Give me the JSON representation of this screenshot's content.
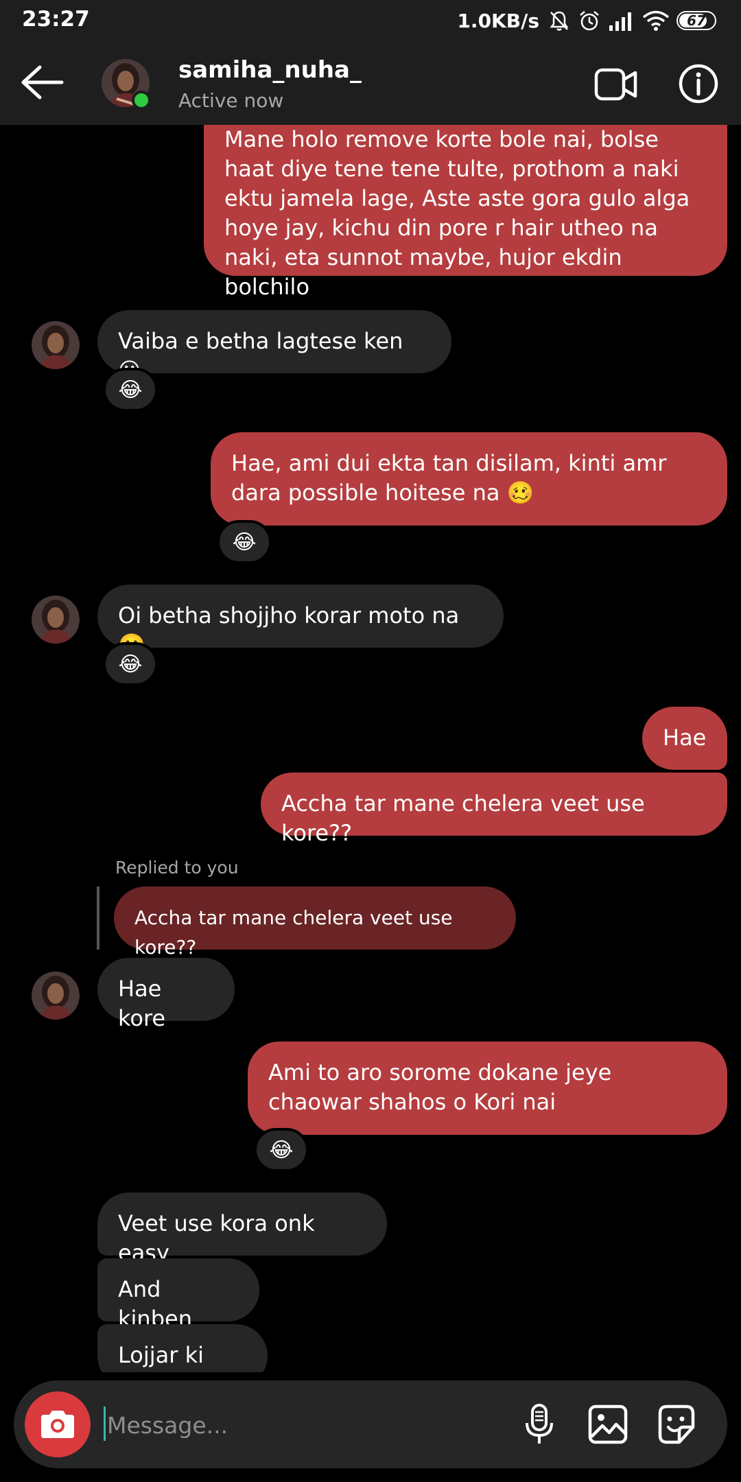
{
  "status_bar": {
    "time": "23:27",
    "network_speed": "1.0KB/s",
    "battery": "67",
    "icons": [
      "mute-icon",
      "alarm-icon",
      "signal-icon",
      "wifi-icon",
      "battery-icon"
    ]
  },
  "header": {
    "username": "samiha_nuha_",
    "status": "Active now",
    "icons": [
      "back-arrow-icon",
      "video-call-icon",
      "info-icon"
    ],
    "online_color": "#2ecc40"
  },
  "messages": [
    {
      "from": "me",
      "text": "Mane holo remove korte bole nai, bolse haat diye tene tene tulte, prothom a naki ektu jamela lage, Aste aste gora gulo alga hoye jay, kichu din pore r hair utheo na naki, eta sunnot maybe, hujor ekdin bolchilo"
    },
    {
      "from": "them",
      "text": "Vaiba e betha lagtese ken 😶",
      "reaction": "😂"
    },
    {
      "from": "me",
      "text": "Hae, ami dui ekta tan disilam, kinti amr dara possible hoitese na 🥴",
      "reaction": "😂"
    },
    {
      "from": "them",
      "text": "Oi betha shojjho korar moto na 🙂",
      "reaction": "😂"
    },
    {
      "from": "me",
      "text": "Hae"
    },
    {
      "from": "me",
      "text": "Accha tar mane chelera veet use kore??"
    },
    {
      "from": "them",
      "text": "Hae kore",
      "replied_label": "Replied to you",
      "reply_to": "Accha tar mane chelera veet use kore??"
    },
    {
      "from": "me",
      "text": "Ami to aro sorome dokane jeye chaowar shahos o Kori nai",
      "reaction": "😂"
    },
    {
      "from": "them",
      "text": "Veet use kora onk easy"
    },
    {
      "from": "them",
      "text": "And kinben"
    },
    {
      "from": "them",
      "text": "Lojjar ki ase"
    }
  ],
  "composer": {
    "placeholder": "Message...",
    "icons": [
      "camera-icon",
      "microphone-icon",
      "gallery-icon",
      "sticker-icon"
    ]
  },
  "colors": {
    "sent_bubble": "#b53d3f",
    "received_bubble": "#262626",
    "reply_quote_bubble": "#6a2426",
    "camera_button": "#d93a3d",
    "background": "#000000",
    "bar_background": "#1e1e1e"
  }
}
